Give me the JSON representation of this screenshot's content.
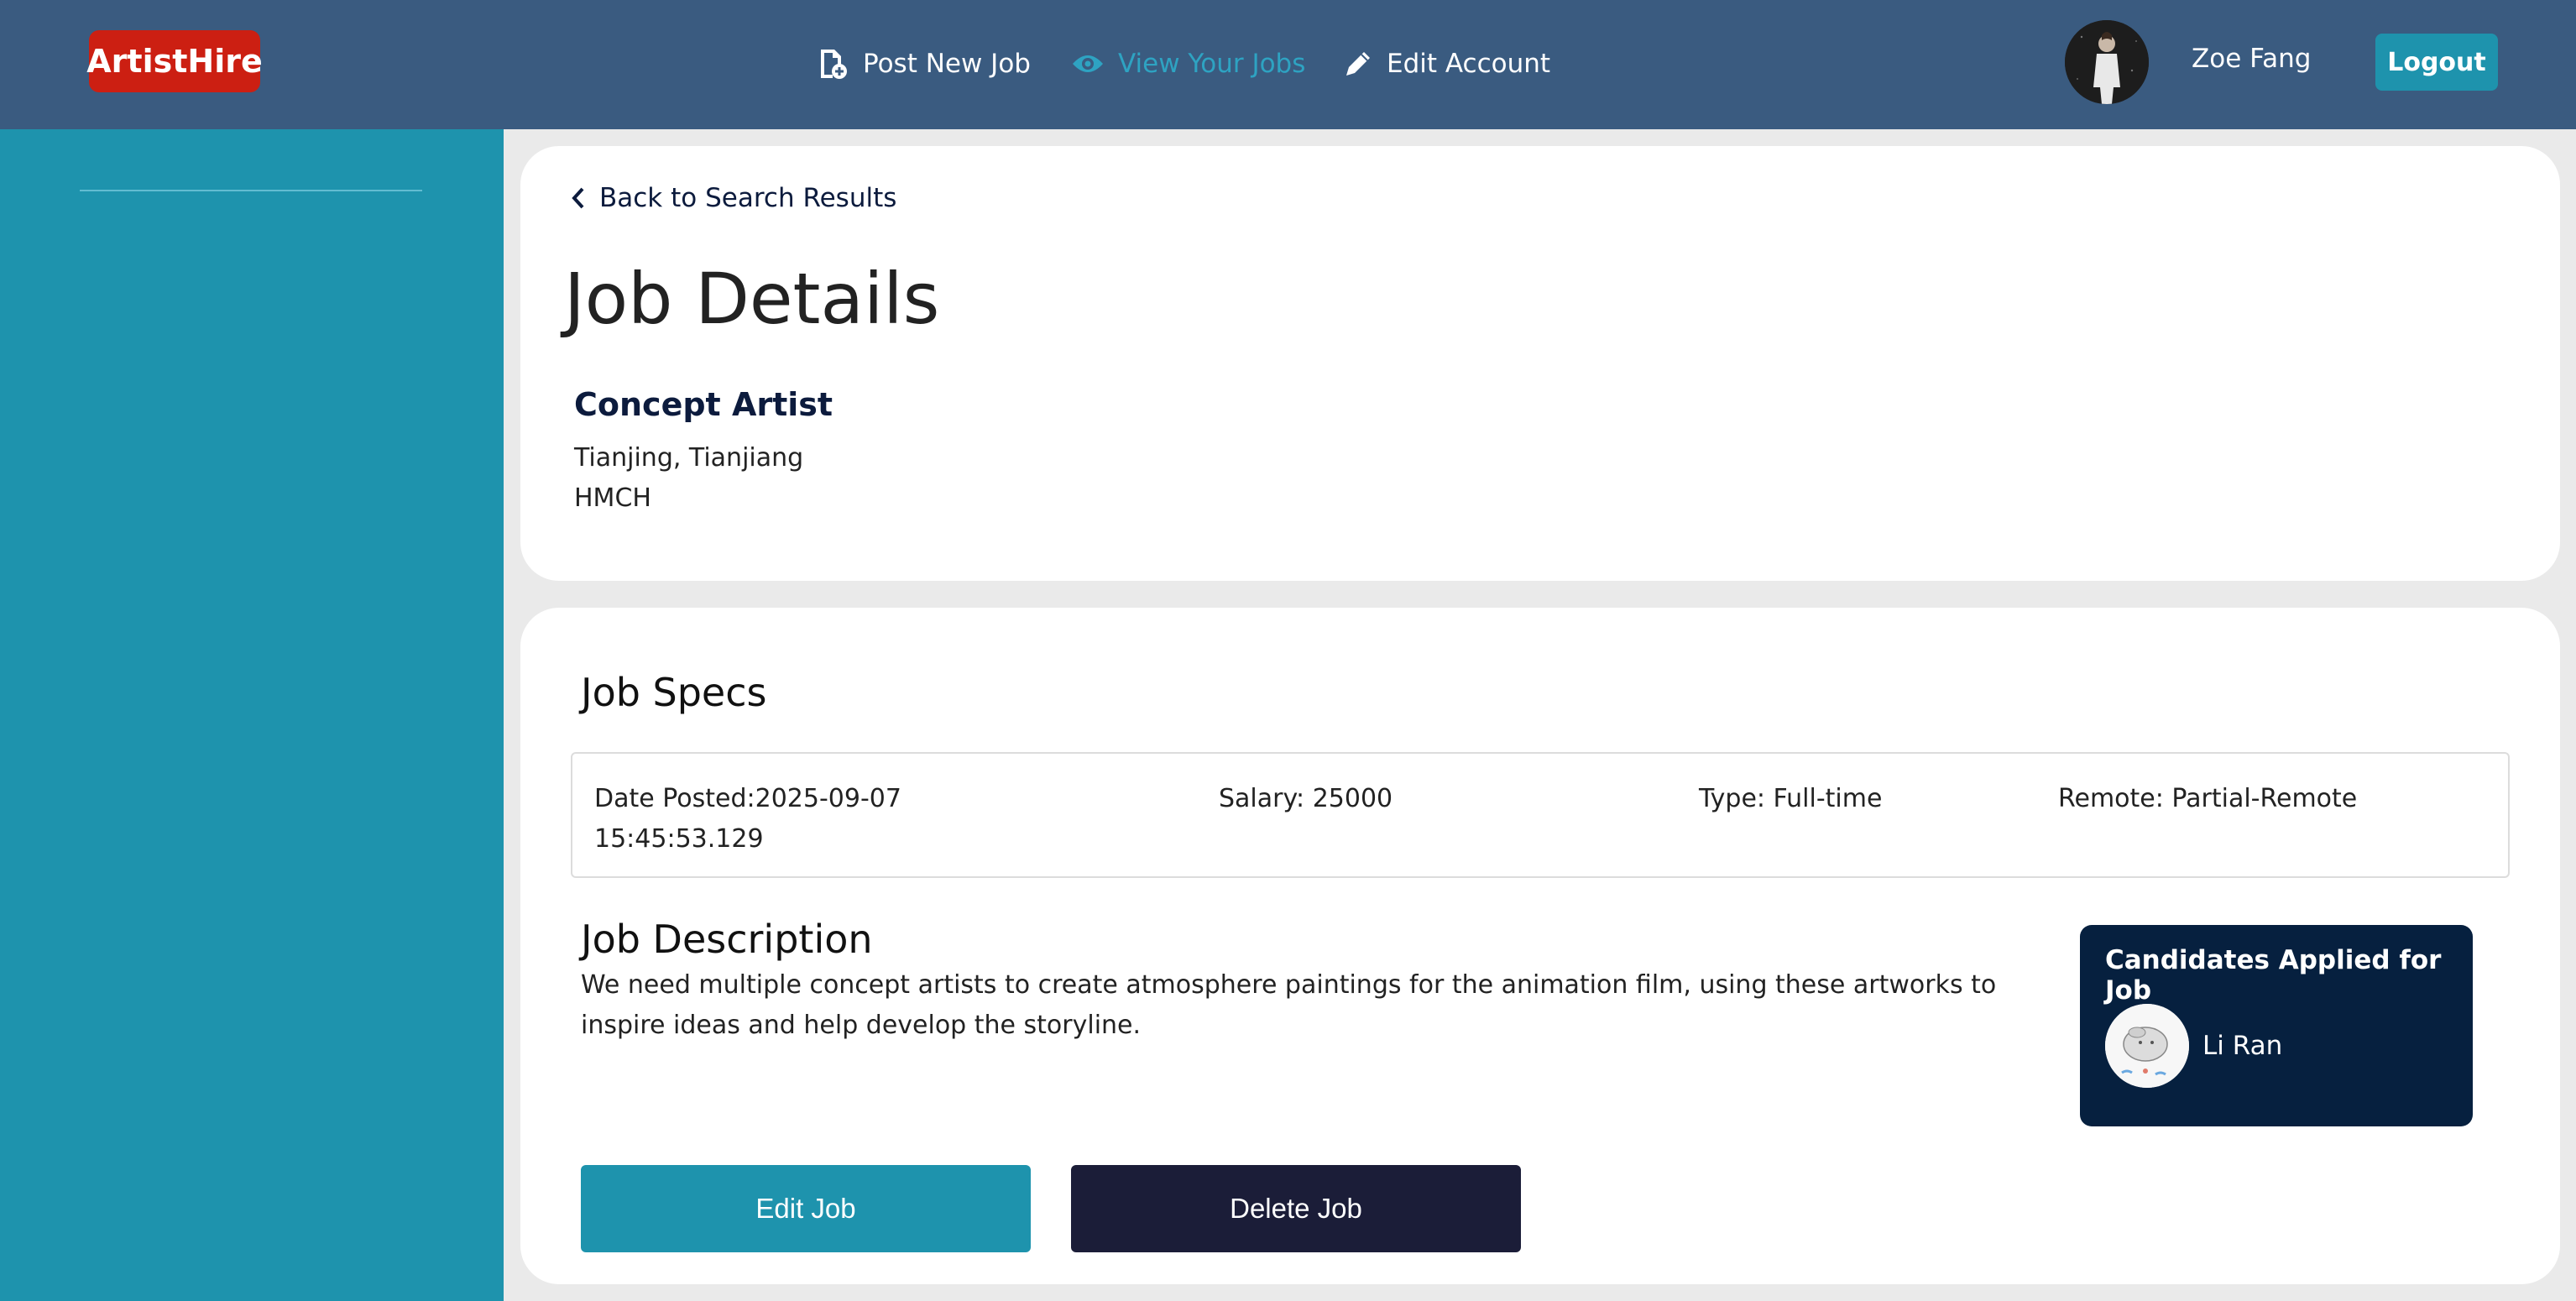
{
  "brand": {
    "logo": "ArtistHire",
    "color": "#cc1f12"
  },
  "nav": {
    "post_new_job": "Post New Job",
    "view_your_jobs": "View Your Jobs",
    "edit_account": "Edit Account"
  },
  "user": {
    "name": "Zoe Fang",
    "logout": "Logout"
  },
  "colors": {
    "nav_bg": "#3a5b80",
    "sidebar_bg": "#1e93ad",
    "active_link": "#2ea3c2",
    "dark_panel": "#06203f",
    "delete_btn": "#1b1d38"
  },
  "page": {
    "back_link": "Back to Search Results",
    "title": "Job Details"
  },
  "job": {
    "title": "Concept Artist",
    "location": "Tianjing, Tianjiang",
    "company": "HMCH"
  },
  "specs": {
    "heading": "Job Specs",
    "date_posted": "Date Posted:2025-09-07 15:45:53.129",
    "salary": "Salary: 25000",
    "type": "Type: Full-time",
    "remote": "Remote: Partial-Remote"
  },
  "description": {
    "heading": "Job Description",
    "text": "We need multiple concept artists to create atmosphere paintings for the animation film, using these artworks to inspire ideas and help develop the storyline."
  },
  "candidates": {
    "heading": "Candidates Applied for Job",
    "items": [
      {
        "name": "Li Ran"
      }
    ]
  },
  "actions": {
    "edit": "Edit Job",
    "delete": "Delete Job"
  },
  "icons": {
    "post": "file-plus-icon",
    "view": "eye-icon",
    "edit": "pencil-icon",
    "back": "chevron-left-icon"
  }
}
